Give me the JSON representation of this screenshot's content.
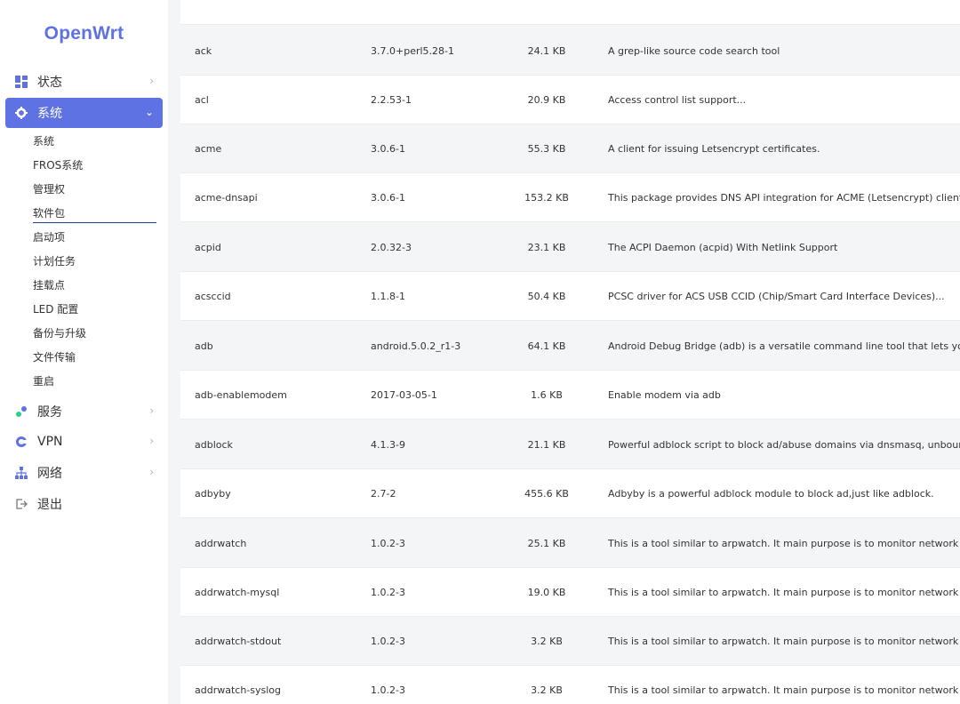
{
  "brand": "OpenWrt",
  "sidebar": {
    "items": [
      {
        "label": "状态",
        "icon": "dashboard-icon"
      },
      {
        "label": "系统",
        "icon": "gear-icon"
      },
      {
        "label": "服务",
        "icon": "services-icon"
      },
      {
        "label": "VPN",
        "icon": "vpn-icon"
      },
      {
        "label": "网络",
        "icon": "network-icon"
      },
      {
        "label": "退出",
        "icon": "logout-icon"
      }
    ],
    "sub_items": [
      "系统",
      "FROS系统",
      "管理权",
      "软件包",
      "启动项",
      "计划任务",
      "挂载点",
      "LED 配置",
      "备份与升级",
      "文件传输",
      "重启"
    ]
  },
  "packages": [
    {
      "name": "ack",
      "version": "3.7.0+perl5.28-1",
      "size": "24.1 KB",
      "description": "A grep-like source code search tool"
    },
    {
      "name": "acl",
      "version": "2.2.53-1",
      "size": "20.9 KB",
      "description": "Access control list support..."
    },
    {
      "name": "acme",
      "version": "3.0.6-1",
      "size": "55.3 KB",
      "description": "A client for issuing Letsencrypt certificates."
    },
    {
      "name": "acme-dnsapi",
      "version": "3.0.6-1",
      "size": "153.2 KB",
      "description": "This package provides DNS API integration for ACME (Letsencrypt) client."
    },
    {
      "name": "acpid",
      "version": "2.0.32-3",
      "size": "23.1 KB",
      "description": "The ACPI Daemon (acpid) With Netlink Support"
    },
    {
      "name": "acsccid",
      "version": "1.1.8-1",
      "size": "50.4 KB",
      "description": "PCSC driver for ACS USB CCID (Chip/Smart Card Interface Devices)..."
    },
    {
      "name": "adb",
      "version": "android.5.0.2_r1-3",
      "size": "64.1 KB",
      "description": "Android Debug Bridge (adb) is a versatile command line tool that lets you communicate w"
    },
    {
      "name": "adb-enablemodem",
      "version": "2017-03-05-1",
      "size": "1.6 KB",
      "description": "Enable modem via adb"
    },
    {
      "name": "adblock",
      "version": "4.1.3-9",
      "size": "21.1 KB",
      "description": "Powerful adblock script to block ad/abuse domains via dnsmasq, unbound, named or kres"
    },
    {
      "name": "adbyby",
      "version": "2.7-2",
      "size": "455.6 KB",
      "description": "Adbyby is a powerful adblock module to block ad,just like adblock."
    },
    {
      "name": "addrwatch",
      "version": "1.0.2-3",
      "size": "25.1 KB",
      "description": "This is a tool similar to arpwatch. It main purpose is to monitor network and..."
    },
    {
      "name": "addrwatch-mysql",
      "version": "1.0.2-3",
      "size": "19.0 KB",
      "description": "This is a tool similar to arpwatch. It main purpose is to monitor network and..."
    },
    {
      "name": "addrwatch-stdout",
      "version": "1.0.2-3",
      "size": "3.2 KB",
      "description": "This is a tool similar to arpwatch. It main purpose is to monitor network and..."
    },
    {
      "name": "addrwatch-syslog",
      "version": "1.0.2-3",
      "size": "3.2 KB",
      "description": "This is a tool similar to arpwatch. It main purpose is to monitor network and..."
    }
  ],
  "colors": {
    "accent": "#5e72e4",
    "sidebar_bg": "#ffffff",
    "row_alt": "#f4f5f7"
  }
}
